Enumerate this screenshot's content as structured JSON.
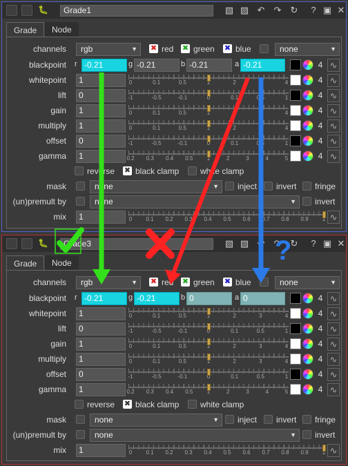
{
  "panels": [
    {
      "id": "panel1",
      "name": "Grade1",
      "tabs": [
        "Grade",
        "Node"
      ],
      "channels": {
        "label": "channels",
        "value": "rgb",
        "red": "red",
        "green": "green",
        "blue": "blue",
        "extra": "none"
      },
      "blackpoint": {
        "label": "blackpoint",
        "r": "-0.21",
        "g": "-0.21",
        "b": "-0.21",
        "a": "-0.21"
      },
      "whitepoint": {
        "label": "whitepoint",
        "value": "1"
      },
      "lift": {
        "label": "lift",
        "value": "0"
      },
      "gain": {
        "label": "gain",
        "value": "1"
      },
      "multiply": {
        "label": "multiply",
        "value": "1"
      },
      "offset": {
        "label": "offset",
        "value": "0"
      },
      "gamma": {
        "label": "gamma",
        "value": "1"
      },
      "checks": {
        "reverse": "reverse",
        "black_clamp": "black clamp",
        "white_clamp": "white clamp"
      },
      "mask": {
        "label": "mask",
        "value": "none",
        "inject": "inject",
        "invert": "invert",
        "fringe": "fringe"
      },
      "premult": {
        "label": "(un)premult by",
        "value": "none",
        "invert": "invert"
      },
      "mix": {
        "label": "mix",
        "value": "1"
      },
      "four": "4"
    },
    {
      "id": "panel2",
      "name": "Grade3",
      "tabs": [
        "Grade",
        "Node"
      ],
      "channels": {
        "label": "channels",
        "value": "rgb",
        "red": "red",
        "green": "green",
        "blue": "blue",
        "extra": "none"
      },
      "blackpoint": {
        "label": "blackpoint",
        "r": "-0.21",
        "g": "-0.21",
        "b": "0",
        "a": "0"
      },
      "whitepoint": {
        "label": "whitepoint",
        "value": "1"
      },
      "lift": {
        "label": "lift",
        "value": "0"
      },
      "gain": {
        "label": "gain",
        "value": "1"
      },
      "multiply": {
        "label": "multiply",
        "value": "1"
      },
      "offset": {
        "label": "offset",
        "value": "0"
      },
      "gamma": {
        "label": "gamma",
        "value": "1"
      },
      "checks": {
        "reverse": "reverse",
        "black_clamp": "black clamp",
        "white_clamp": "white clamp"
      },
      "mask": {
        "label": "mask",
        "value": "none",
        "inject": "inject",
        "invert": "invert",
        "fringe": "fringe"
      },
      "premult": {
        "label": "(un)premult by",
        "value": "none",
        "invert": "invert"
      },
      "mix": {
        "label": "mix",
        "value": "1"
      },
      "four": "4"
    }
  ],
  "sliders": {
    "whitepoint": [
      "0",
      "0.1",
      "0.5",
      "1",
      "2",
      "3",
      "4"
    ],
    "lift": [
      "-1",
      "-0.5",
      "-0.1",
      "0",
      "0.1",
      "0.5",
      "1"
    ],
    "gain": [
      "0",
      "0.1",
      "0.5",
      "1",
      "2",
      "3",
      "4"
    ],
    "multiply": [
      "0",
      "0.1",
      "0.5",
      "1",
      "2",
      "3",
      "4"
    ],
    "offset": [
      "-1",
      "-0.5",
      "-0.1",
      "0",
      "0.1",
      "0.5",
      "1"
    ],
    "gamma": [
      "0.2",
      "0.3",
      "0.4",
      "0.5",
      "1",
      "2",
      "3",
      "4",
      "5"
    ],
    "mix": [
      "0",
      "0.1",
      "0.2",
      "0.3",
      "0.4",
      "0.5",
      "0.6",
      "0.7",
      "0.8",
      "0.9",
      "1"
    ]
  },
  "channel_labels": {
    "r": "r",
    "g": "g",
    "b": "b",
    "a": "a"
  },
  "annotations": {
    "question": "?"
  },
  "colors": {
    "cyan_field": "#18d4e0",
    "teal_field": "#7fb3b5",
    "panel1_border": "#4d63c9",
    "panel2_border": "#b83030",
    "arrow_green": "#33e01a",
    "arrow_red": "#ff2222",
    "arrow_blue": "#2b7ae8"
  }
}
